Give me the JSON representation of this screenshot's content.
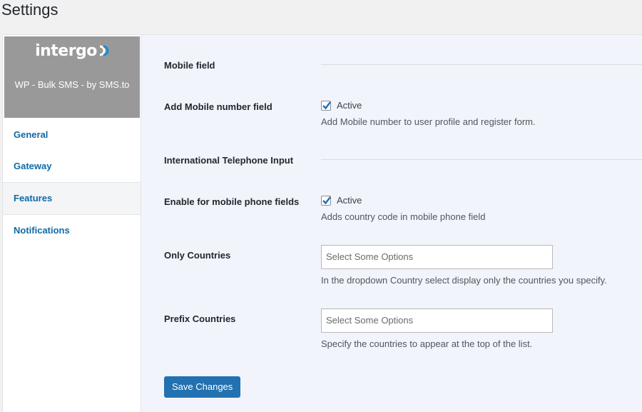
{
  "page": {
    "title": "Settings"
  },
  "brand": {
    "logo_text": "intergo",
    "subtitle": "WP - Bulk SMS - by SMS.to",
    "colors": {
      "panel": "#999999",
      "dot": "#1f8ad2"
    }
  },
  "sidebar": {
    "items": [
      {
        "label": "General",
        "active": false
      },
      {
        "label": "Gateway",
        "active": false
      },
      {
        "label": "Features",
        "active": true
      },
      {
        "label": "Notifications",
        "active": false
      }
    ]
  },
  "form": {
    "mobile_section": {
      "heading": "Mobile field"
    },
    "add_mobile": {
      "label": "Add Mobile number field",
      "checkbox_label": "Active",
      "checked": true,
      "description": "Add Mobile number to user profile and register form."
    },
    "intl_section": {
      "heading": "International Telephone Input"
    },
    "enable_mobile": {
      "label": "Enable for mobile phone fields",
      "checkbox_label": "Active",
      "checked": true,
      "description": "Adds country code in mobile phone field"
    },
    "only_countries": {
      "label": "Only Countries",
      "placeholder": "Select Some Options",
      "description": "In the dropdown Country select display only the countries you specify."
    },
    "prefix_countries": {
      "label": "Prefix Countries",
      "placeholder": "Select Some Options",
      "description": "Specify the countries to appear at the top of the list."
    },
    "save_label": "Save Changes"
  },
  "colors": {
    "accent": "#2271b1",
    "link": "#0f6aa5"
  }
}
